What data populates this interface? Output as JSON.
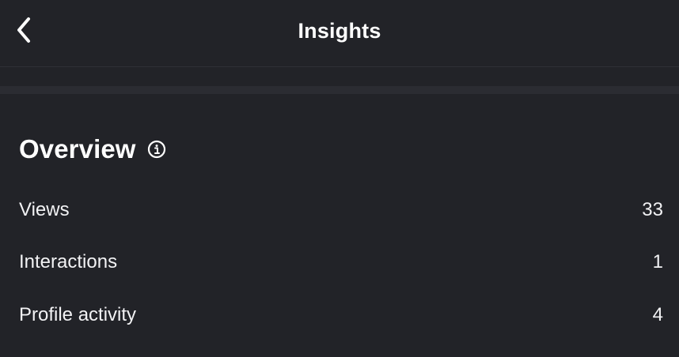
{
  "header": {
    "title": "Insights",
    "back_icon": "chevron-left-icon"
  },
  "overview": {
    "title": "Overview",
    "info_icon": "info-icon",
    "metrics": [
      {
        "label": "Views",
        "value": "33"
      },
      {
        "label": "Interactions",
        "value": "1"
      },
      {
        "label": "Profile activity",
        "value": "4"
      }
    ]
  },
  "colors": {
    "background": "#222328",
    "text": "#ffffff",
    "band": "#2b2c32"
  }
}
